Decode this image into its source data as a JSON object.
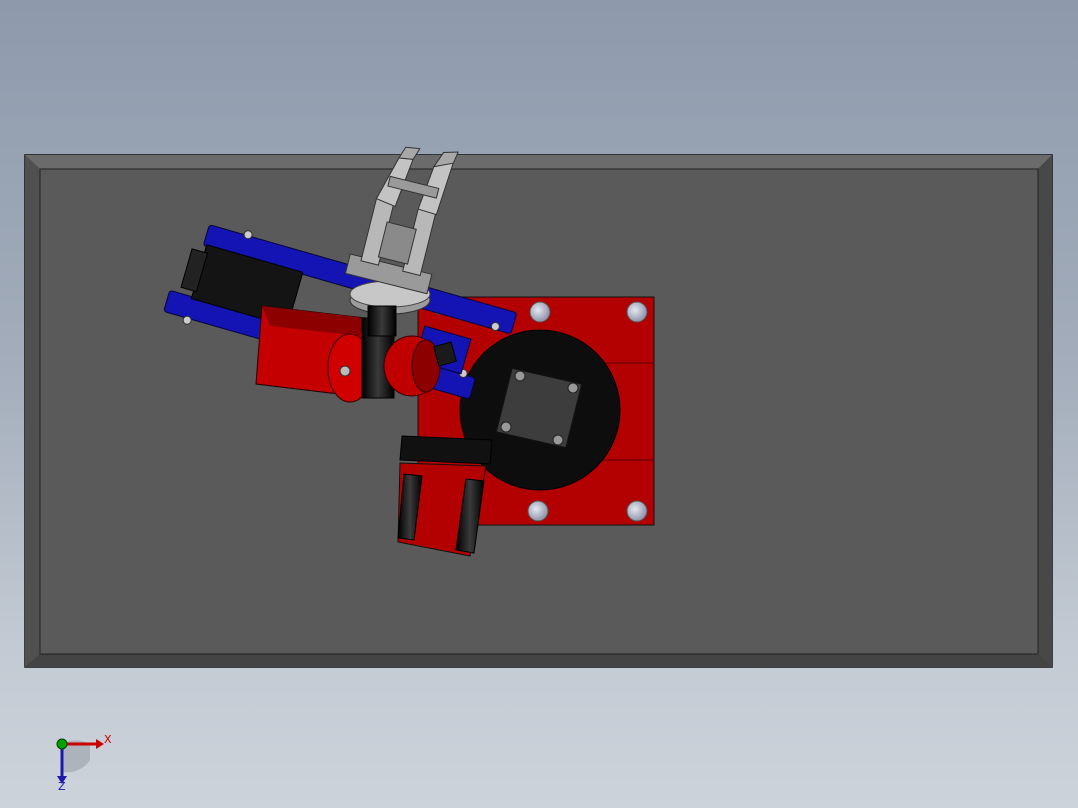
{
  "viewport": {
    "background_top": "#8e9aac",
    "background_bottom": "#cdd3db"
  },
  "model": {
    "base_plate_color": "#5a5a5a",
    "red_part_color": "#b30000",
    "blue_part_color": "#1414b4",
    "black_part_color": "#111111",
    "gripper_color": "#b4b4b4"
  },
  "triad": {
    "x_label": "X",
    "z_label": "Z",
    "x_color": "#cc0000",
    "z_color": "#1a1aa6",
    "y_color": "#00a000"
  }
}
